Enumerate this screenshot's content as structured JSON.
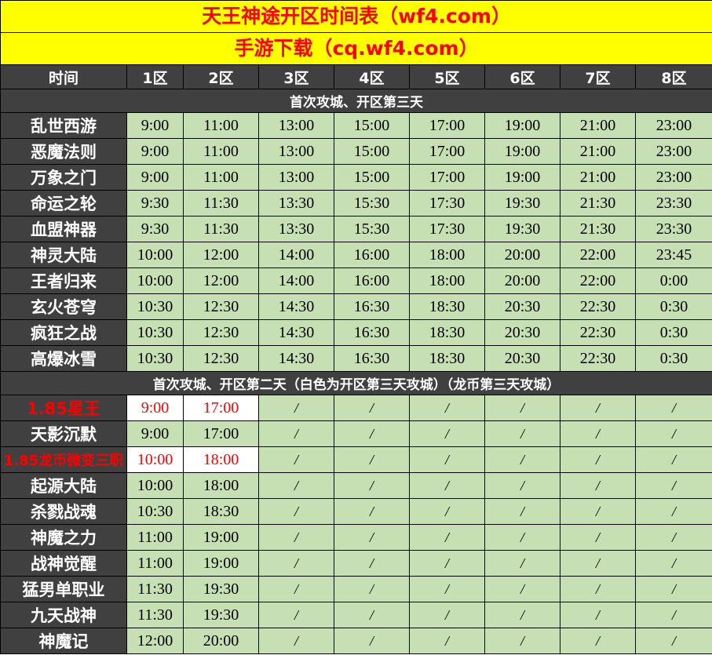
{
  "title": {
    "line1": "天王神途开区时间表（wf4.com）",
    "line2": "手游下载（cq.wf4.com）"
  },
  "header": [
    "时间",
    "1区",
    "2区",
    "3区",
    "4区",
    "5区",
    "6区",
    "7区",
    "8区"
  ],
  "sections": [
    {
      "label": "首次攻城、开区第三天",
      "rows": [
        {
          "name": "乱世西游",
          "times": [
            "9:00",
            "11:00",
            "13:00",
            "15:00",
            "17:00",
            "19:00",
            "21:00",
            "23:00"
          ]
        },
        {
          "name": "恶魔法则",
          "times": [
            "9:00",
            "11:00",
            "13:00",
            "15:00",
            "17:00",
            "19:00",
            "21:00",
            "23:00"
          ]
        },
        {
          "name": "万象之门",
          "times": [
            "9:00",
            "11:00",
            "13:00",
            "15:00",
            "17:00",
            "19:00",
            "21:00",
            "23:00"
          ]
        },
        {
          "name": "命运之轮",
          "times": [
            "9:30",
            "11:30",
            "13:30",
            "15:30",
            "17:30",
            "19:30",
            "21:30",
            "23:30"
          ]
        },
        {
          "name": "血盟神器",
          "times": [
            "9:30",
            "11:30",
            "13:30",
            "15:30",
            "17:30",
            "19:30",
            "21:30",
            "23:30"
          ]
        },
        {
          "name": "神灵大陆",
          "times": [
            "10:00",
            "12:00",
            "14:00",
            "16:00",
            "18:00",
            "20:00",
            "22:00",
            "23:45"
          ]
        },
        {
          "name": "王者归来",
          "times": [
            "10:00",
            "12:00",
            "14:00",
            "16:00",
            "18:00",
            "20:00",
            "22:00",
            "0:00"
          ]
        },
        {
          "name": "玄火苍穹",
          "times": [
            "10:30",
            "12:30",
            "14:30",
            "16:30",
            "18:30",
            "20:30",
            "22:30",
            "0:30"
          ]
        },
        {
          "name": "疯狂之战",
          "times": [
            "10:30",
            "12:30",
            "14:30",
            "16:30",
            "18:30",
            "20:30",
            "22:30",
            "0:30"
          ]
        },
        {
          "name": "高爆冰雪",
          "times": [
            "10:30",
            "12:30",
            "14:30",
            "16:30",
            "18:30",
            "20:30",
            "22:30",
            "0:30"
          ]
        }
      ]
    },
    {
      "label": "首次攻城、开区第二天（白色为开区第三天攻城）（龙币第三天攻城）",
      "rows": [
        {
          "name": "1.85星王",
          "red": true,
          "times": [
            "9:00",
            "17:00",
            "/",
            "/",
            "/",
            "/",
            "/",
            "/"
          ]
        },
        {
          "name": "天影沉默",
          "times": [
            "9:00",
            "17:00",
            "/",
            "/",
            "/",
            "/",
            "/",
            "/"
          ]
        },
        {
          "name": "1.85龙币微变三职",
          "red": true,
          "times": [
            "10:00",
            "18:00",
            "/",
            "/",
            "/",
            "/",
            "/",
            "/"
          ]
        },
        {
          "name": "起源大陆",
          "times": [
            "10:00",
            "18:00",
            "/",
            "/",
            "/",
            "/",
            "/",
            "/"
          ]
        },
        {
          "name": "杀戮战魂",
          "times": [
            "10:30",
            "18:30",
            "/",
            "/",
            "/",
            "/",
            "/",
            "/"
          ]
        },
        {
          "name": "神魔之力",
          "times": [
            "11:00",
            "19:00",
            "/",
            "/",
            "/",
            "/",
            "/",
            "/"
          ]
        },
        {
          "name": "战神觉醒",
          "times": [
            "11:00",
            "19:00",
            "/",
            "/",
            "/",
            "/",
            "/",
            "/"
          ]
        },
        {
          "name": "猛男单职业",
          "times": [
            "11:30",
            "19:30",
            "/",
            "/",
            "/",
            "/",
            "/",
            "/"
          ]
        },
        {
          "name": "九天战神",
          "times": [
            "11:30",
            "19:30",
            "/",
            "/",
            "/",
            "/",
            "/",
            "/"
          ]
        },
        {
          "name": "神魔记",
          "times": [
            "12:00",
            "20:00",
            "/",
            "/",
            "/",
            "/",
            "/",
            "/"
          ]
        }
      ]
    }
  ],
  "colors": {
    "title_bg": "#ffff00",
    "title_text": "#ff0000",
    "header_bg": "#404040",
    "cell_green": "#c6e0b4",
    "highlight_red": "#ff0000"
  }
}
